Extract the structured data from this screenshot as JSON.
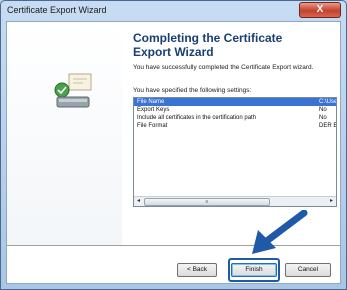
{
  "window": {
    "title": "Certificate Export Wizard",
    "close_label": "X"
  },
  "heading": "Completing the Certificate Export Wizard",
  "description": "You have successfully completed the Certificate Export wizard.",
  "settings_label": "You have specified the following settings:",
  "settings": [
    {
      "name": "File Name",
      "value": "C:\\Use",
      "selected": true
    },
    {
      "name": "Export Keys",
      "value": "No",
      "selected": false
    },
    {
      "name": "Include all certificates in the certification path",
      "value": "No",
      "selected": false
    },
    {
      "name": "File Format",
      "value": "DER En",
      "selected": false
    }
  ],
  "scrollbar": {
    "left_arrow": "◂",
    "right_arrow": "▸",
    "thumb_grip": "≡"
  },
  "buttons": {
    "back": "< Back",
    "finish": "Finish",
    "cancel": "Cancel"
  },
  "colors": {
    "heading": "#1a3f73",
    "selection": "#3a73d4",
    "annotation_arrow": "#1f5aa8"
  }
}
